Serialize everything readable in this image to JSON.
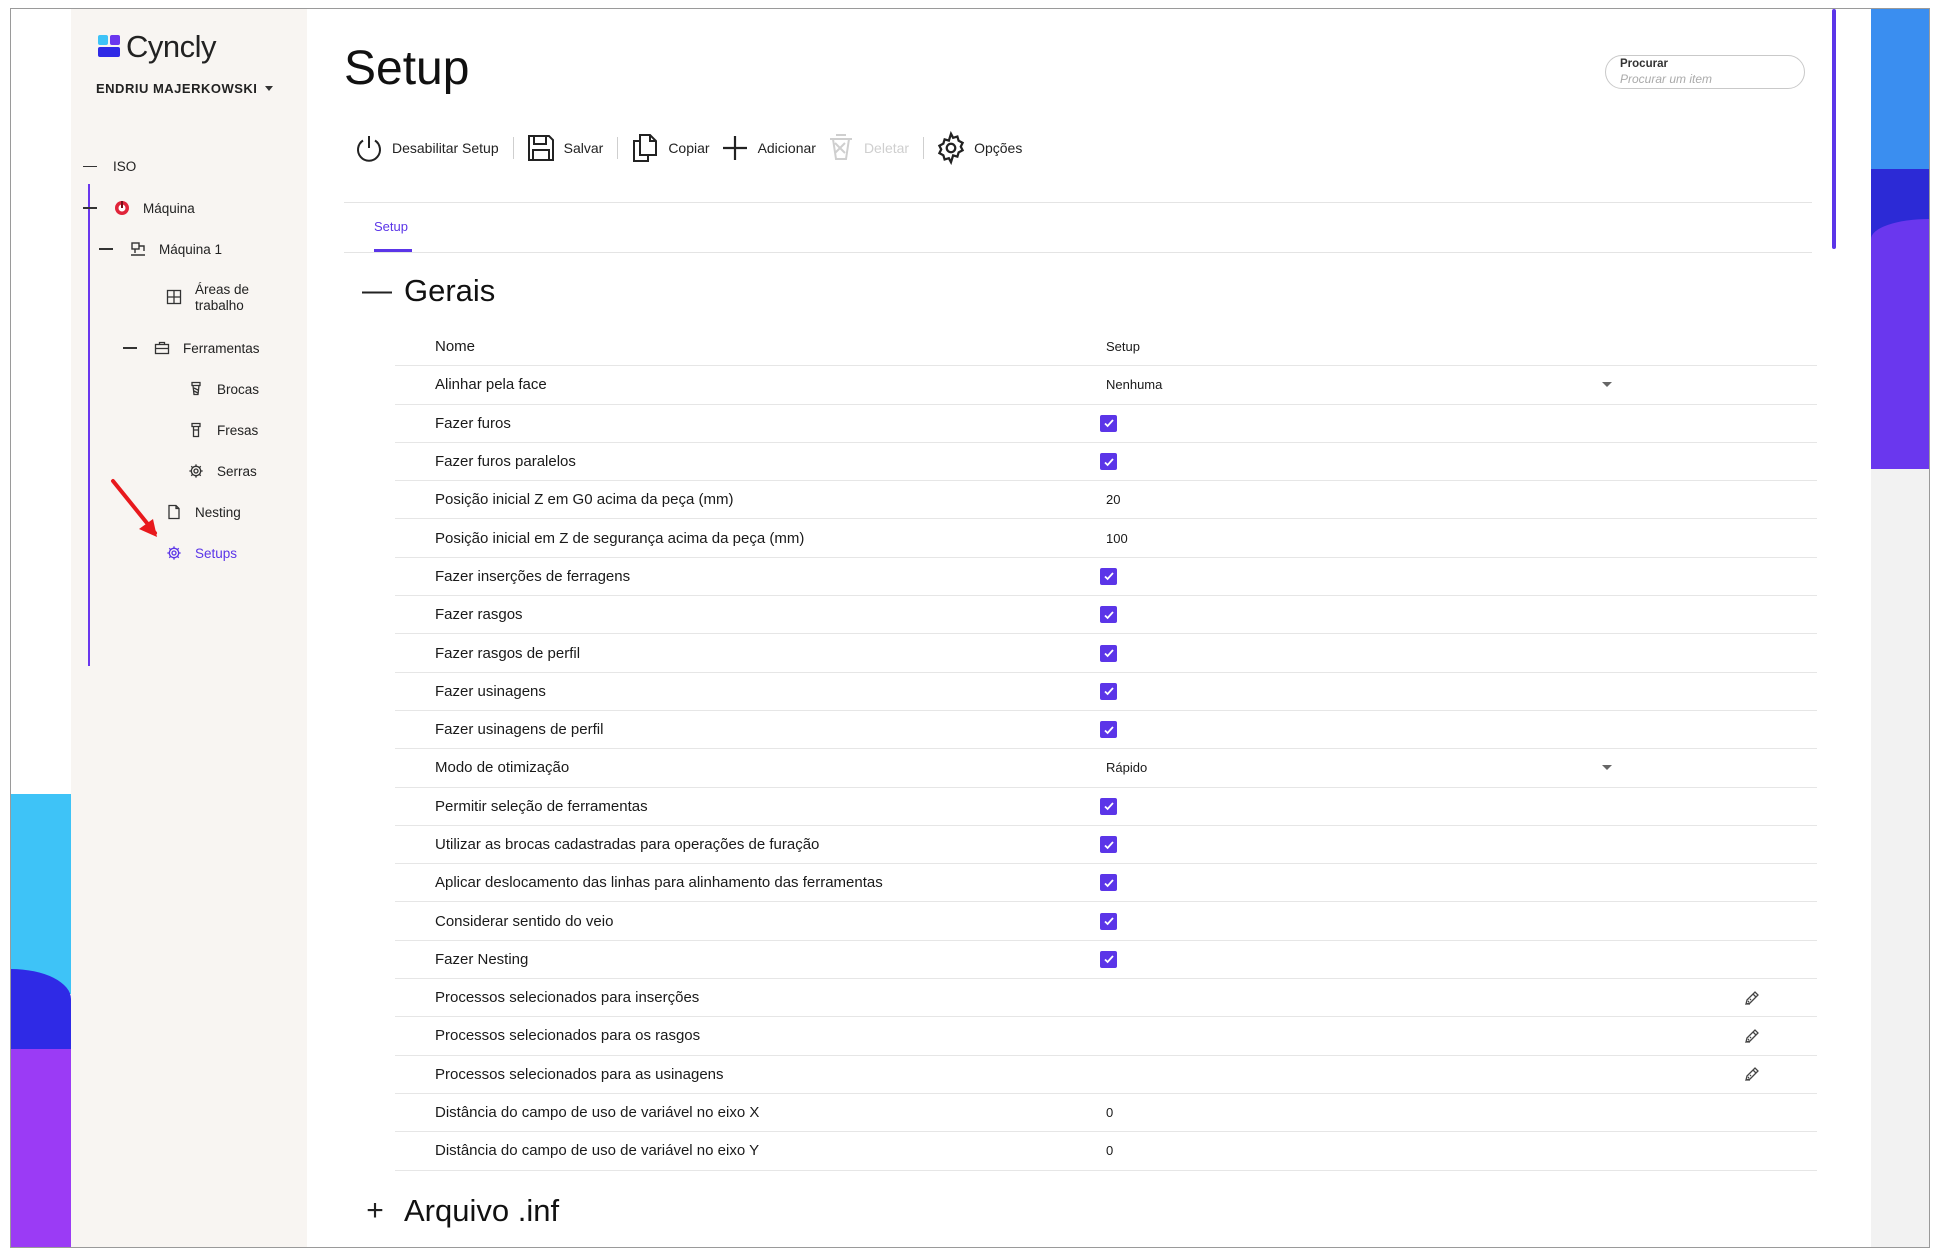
{
  "app": {
    "brand": "Cyncly",
    "user": "ENDRIU MAJERKOWSKI"
  },
  "sidebar": {
    "items": [
      {
        "label": "ISO",
        "icon": "dash"
      },
      {
        "label": "Máquina",
        "icon": "machine-red-icon"
      },
      {
        "label": "Máquina 1",
        "icon": "cnc-machine-icon"
      },
      {
        "label": "Áreas de trabalho",
        "icon": "grid-icon"
      },
      {
        "label": "Ferramentas",
        "icon": "toolbox-icon"
      },
      {
        "label": "Brocas",
        "icon": "drill-bit-icon"
      },
      {
        "label": "Fresas",
        "icon": "mill-icon"
      },
      {
        "label": "Serras",
        "icon": "saw-gear-icon"
      },
      {
        "label": "Nesting",
        "icon": "document-icon"
      },
      {
        "label": "Setups",
        "icon": "gear-icon",
        "active": true
      }
    ]
  },
  "header": {
    "title": "Setup",
    "search": {
      "label": "Procurar",
      "placeholder": "Procurar um item"
    }
  },
  "toolbar": {
    "disable_setup": "Desabilitar Setup",
    "save": "Salvar",
    "copy": "Copiar",
    "add": "Adicionar",
    "delete": "Deletar",
    "options": "Opções"
  },
  "tabs": [
    {
      "label": "Setup",
      "active": true
    }
  ],
  "sections": {
    "general": {
      "title": "Gerais",
      "expanded": true,
      "rows": [
        {
          "name": "Nome",
          "type": "text",
          "value": "Setup"
        },
        {
          "name": "Alinhar pela face",
          "type": "select",
          "value": "Nenhuma"
        },
        {
          "name": "Fazer furos",
          "type": "checkbox",
          "value": true
        },
        {
          "name": "Fazer furos paralelos",
          "type": "checkbox",
          "value": true
        },
        {
          "name": "Posição inicial Z em G0 acima da peça (mm)",
          "type": "text",
          "value": "20"
        },
        {
          "name": "Posição inicial em Z de segurança acima da peça (mm)",
          "type": "text",
          "value": "100"
        },
        {
          "name": "Fazer inserções de ferragens",
          "type": "checkbox",
          "value": true
        },
        {
          "name": "Fazer rasgos",
          "type": "checkbox",
          "value": true
        },
        {
          "name": "Fazer rasgos de perfil",
          "type": "checkbox",
          "value": true
        },
        {
          "name": "Fazer usinagens",
          "type": "checkbox",
          "value": true
        },
        {
          "name": "Fazer usinagens de perfil",
          "type": "checkbox",
          "value": true
        },
        {
          "name": "Modo de otimização",
          "type": "select",
          "value": "Rápido"
        },
        {
          "name": "Permitir seleção de ferramentas",
          "type": "checkbox",
          "value": true
        },
        {
          "name": "Utilizar as brocas cadastradas para operações de furação",
          "type": "checkbox",
          "value": true
        },
        {
          "name": "Aplicar deslocamento das linhas para alinhamento das ferramentas",
          "type": "checkbox",
          "value": true
        },
        {
          "name": "Considerar sentido do veio",
          "type": "checkbox",
          "value": true
        },
        {
          "name": "Fazer Nesting",
          "type": "checkbox",
          "value": true
        },
        {
          "name": "Processos selecionados para inserções",
          "type": "edit",
          "value": ""
        },
        {
          "name": "Processos selecionados para os rasgos",
          "type": "edit",
          "value": ""
        },
        {
          "name": "Processos selecionados para as usinagens",
          "type": "edit",
          "value": ""
        },
        {
          "name": "Distância do campo de uso de variável no eixo X",
          "type": "text",
          "value": "0"
        },
        {
          "name": "Distância do campo de uso de variável no eixo Y",
          "type": "text",
          "value": "0"
        }
      ]
    },
    "file_inf": {
      "title": "Arquivo .inf",
      "expanded": false
    }
  },
  "colors": {
    "accent": "#5b35e8",
    "sidebar_bg": "#f8f5f2",
    "annotation_arrow": "#e8191d"
  }
}
